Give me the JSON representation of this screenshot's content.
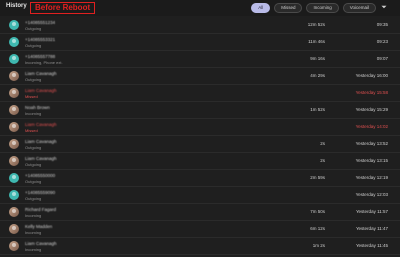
{
  "header": {
    "title": "History",
    "annotation": "Before Reboot",
    "filters": [
      "All",
      "Missed",
      "Incoming",
      "Voicemail"
    ],
    "filter_icon": "funnel-icon"
  },
  "rows": [
    {
      "name": "+14085551234",
      "sub": "Outgoing",
      "duration": "12m 52s",
      "time": "09:35",
      "avatar": "initial",
      "missed": false
    },
    {
      "name": "+14085553321",
      "sub": "Outgoing",
      "duration": "11m 46s",
      "time": "09:23",
      "avatar": "initial",
      "missed": false
    },
    {
      "name": "+14085557788",
      "sub": "Incoming, Phone ext.",
      "duration": "9m 16s",
      "time": "09:07",
      "avatar": "initial",
      "missed": false
    },
    {
      "name": "Liam Cavanagh",
      "sub": "Outgoing",
      "duration": "4m 29s",
      "time": "Yesterday 16:00",
      "avatar": "photo",
      "missed": false
    },
    {
      "name": "Liam Cavanagh",
      "sub": "Missed",
      "duration": "",
      "time": "Yesterday 15:58",
      "avatar": "photo",
      "missed": true
    },
    {
      "name": "Noah Brown",
      "sub": "Incoming",
      "duration": "1m 52s",
      "time": "Yesterday 15:29",
      "avatar": "photo",
      "missed": false
    },
    {
      "name": "Liam Cavanagh",
      "sub": "Missed",
      "duration": "",
      "time": "Yesterday 14:02",
      "avatar": "photo",
      "missed": true
    },
    {
      "name": "Liam Cavanagh",
      "sub": "Outgoing",
      "duration": "2s",
      "time": "Yesterday 13:52",
      "avatar": "photo",
      "missed": false
    },
    {
      "name": "Liam Cavanagh",
      "sub": "Outgoing",
      "duration": "2s",
      "time": "Yesterday 13:15",
      "avatar": "photo",
      "missed": false
    },
    {
      "name": "+14085550000",
      "sub": "Outgoing",
      "duration": "2m 59s",
      "time": "Yesterday 12:19",
      "avatar": "initial",
      "missed": false
    },
    {
      "name": "+14085559090",
      "sub": "Outgoing",
      "duration": "",
      "time": "Yesterday 12:03",
      "avatar": "initial",
      "missed": false
    },
    {
      "name": "Richard Fagard",
      "sub": "Incoming",
      "duration": "7m 50s",
      "time": "Yesterday 11:57",
      "avatar": "photo",
      "missed": false
    },
    {
      "name": "Kelly Madden",
      "sub": "Incoming",
      "duration": "6m 12s",
      "time": "Yesterday 11:47",
      "avatar": "photo",
      "missed": false
    },
    {
      "name": "Liam Cavanagh",
      "sub": "Incoming",
      "duration": "1m 2s",
      "time": "Yesterday 11:45",
      "avatar": "photo",
      "missed": false
    }
  ]
}
